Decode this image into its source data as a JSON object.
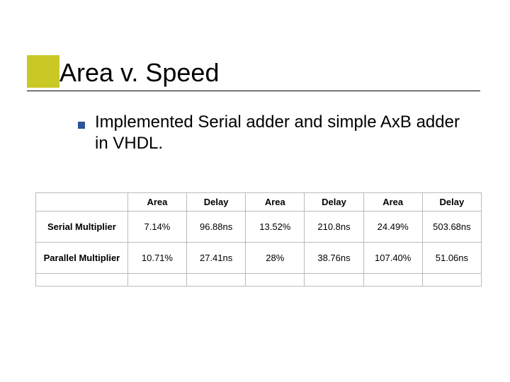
{
  "title": "Area v. Speed",
  "bullet_text": "Implemented Serial adder and simple AxB adder in VHDL.",
  "table": {
    "headers": [
      "",
      "Area",
      "Delay",
      "Area",
      "Delay",
      "Area",
      "Delay"
    ],
    "rows": [
      {
        "label": "Serial Multiplier",
        "cells": [
          "7.14%",
          "96.88ns",
          "13.52%",
          "210.8ns",
          "24.49%",
          "503.68ns"
        ]
      },
      {
        "label": "Parallel Multiplier",
        "cells": [
          "10.71%",
          "27.41ns",
          "28%",
          "38.76ns",
          "107.40%",
          "51.06ns"
        ]
      }
    ]
  },
  "chart_data": {
    "type": "table",
    "title": "Area v. Speed",
    "columns": [
      "Area",
      "Delay",
      "Area",
      "Delay",
      "Area",
      "Delay"
    ],
    "series": [
      {
        "name": "Serial Multiplier",
        "values": [
          "7.14%",
          "96.88ns",
          "13.52%",
          "210.8ns",
          "24.49%",
          "503.68ns"
        ]
      },
      {
        "name": "Parallel Multiplier",
        "values": [
          "10.71%",
          "27.41ns",
          "28%",
          "38.76ns",
          "107.40%",
          "51.06ns"
        ]
      }
    ]
  }
}
